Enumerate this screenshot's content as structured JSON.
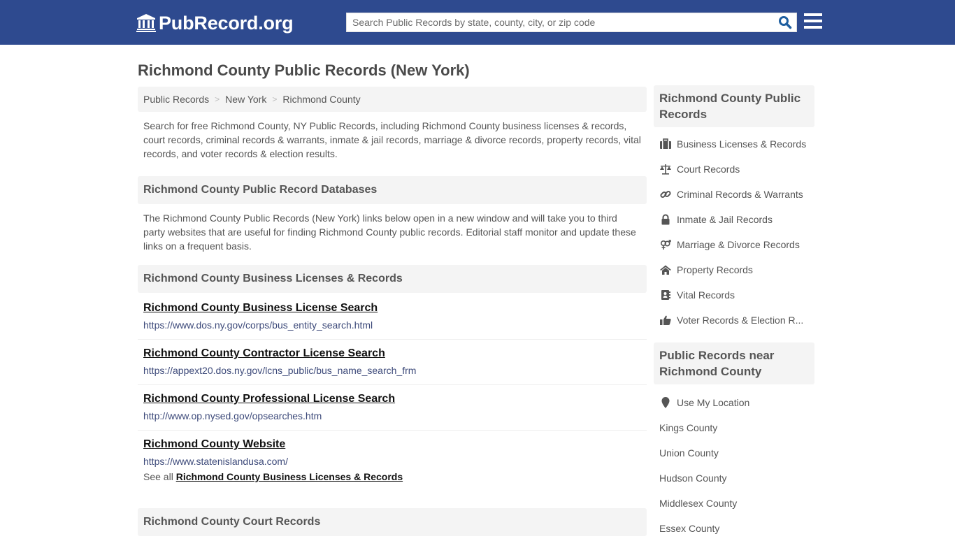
{
  "header": {
    "logo_text": "PubRecord.org",
    "search_placeholder": "Search Public Records by state, county, city, or zip code",
    "search_value": "",
    "colors": {
      "bar": "#2e4a8f",
      "search_icon": "#1f5fa0"
    }
  },
  "page": {
    "title": "Richmond County Public Records (New York)"
  },
  "breadcrumb": [
    {
      "label": "Public Records"
    },
    {
      "label": "New York"
    },
    {
      "label": "Richmond County"
    }
  ],
  "breadcrumb_separator": ">",
  "intro": "Search for free Richmond County, NY Public Records, including Richmond County business licenses & records, court records, criminal records & warrants, inmate & jail records, marriage & divorce records, property records, vital records, and voter records & election results.",
  "databases": {
    "heading": "Richmond County Public Record Databases",
    "description": "The Richmond County Public Records (New York) links below open in a new window and will take you to third party websites that are useful for finding Richmond County public records. Editorial staff monitor and update these links on a frequent basis."
  },
  "business": {
    "heading": "Richmond County Business Licenses & Records",
    "links": [
      {
        "title": "Richmond County Business License Search",
        "url": "https://www.dos.ny.gov/corps/bus_entity_search.html"
      },
      {
        "title": "Richmond County Contractor License Search",
        "url": "https://appext20.dos.ny.gov/lcns_public/bus_name_search_frm"
      },
      {
        "title": "Richmond County Professional License Search",
        "url": "http://www.op.nysed.gov/opsearches.htm"
      },
      {
        "title": "Richmond County Website",
        "url": "https://www.statenislandusa.com/"
      }
    ],
    "see_all_prefix": "See all",
    "see_all_link": "Richmond County Business Licenses & Records"
  },
  "court": {
    "heading": "Richmond County Court Records"
  },
  "sidebar": {
    "records_heading": "Richmond County Public Records",
    "records_items": [
      {
        "icon": "briefcase-icon",
        "label": "Business Licenses & Records"
      },
      {
        "icon": "scales-icon",
        "label": "Court Records"
      },
      {
        "icon": "link-icon",
        "label": "Criminal Records & Warrants"
      },
      {
        "icon": "lock-icon",
        "label": "Inmate & Jail Records"
      },
      {
        "icon": "gender-icon",
        "label": "Marriage & Divorce Records"
      },
      {
        "icon": "home-icon",
        "label": "Property Records"
      },
      {
        "icon": "address-book-icon",
        "label": "Vital Records"
      },
      {
        "icon": "thumbs-up-icon",
        "label": "Voter Records & Election R..."
      }
    ],
    "nearby_heading": "Public Records near Richmond County",
    "location_item": {
      "icon": "map-marker-icon",
      "label": "Use My Location"
    },
    "nearby_items": [
      {
        "label": "Kings County"
      },
      {
        "label": "Union County"
      },
      {
        "label": "Hudson County"
      },
      {
        "label": "Middlesex County"
      },
      {
        "label": "Essex County"
      }
    ]
  }
}
